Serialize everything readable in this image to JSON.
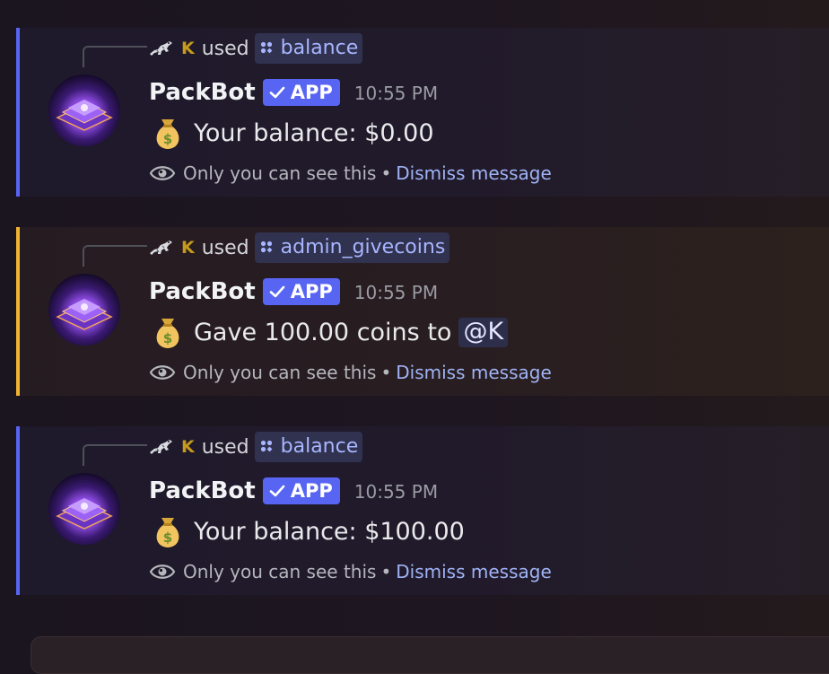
{
  "messages": [
    {
      "accent": "#5865f2",
      "reply": {
        "used_label": "used",
        "command": "balance",
        "user_tag": "K"
      },
      "bot_name": "PackBot",
      "app_badge": "APP",
      "time": "10:55 PM",
      "body_text": "Your balance: $0.00",
      "mention": null,
      "ephemeral": {
        "notice": "Only you can see this",
        "separator": "•",
        "dismiss": "Dismiss message"
      }
    },
    {
      "accent": "#f0b232",
      "reply": {
        "used_label": "used",
        "command": "admin_givecoins",
        "user_tag": "K"
      },
      "bot_name": "PackBot",
      "app_badge": "APP",
      "time": "10:55 PM",
      "body_text": "Gave 100.00 coins to",
      "mention": "@K",
      "ephemeral": {
        "notice": "Only you can see this",
        "separator": "•",
        "dismiss": "Dismiss message"
      }
    },
    {
      "accent": "#5865f2",
      "reply": {
        "used_label": "used",
        "command": "balance",
        "user_tag": "K"
      },
      "bot_name": "PackBot",
      "app_badge": "APP",
      "time": "10:55 PM",
      "body_text": "Your balance: $100.00",
      "mention": null,
      "ephemeral": {
        "notice": "Only you can see this",
        "separator": "•",
        "dismiss": "Dismiss message"
      }
    }
  ],
  "icons": {
    "reply_avatar": "reptile-avatar-icon",
    "command": "slash-command-icon",
    "verified": "checkmark-icon",
    "money": "money-bag-icon",
    "visibility": "eye-icon"
  }
}
